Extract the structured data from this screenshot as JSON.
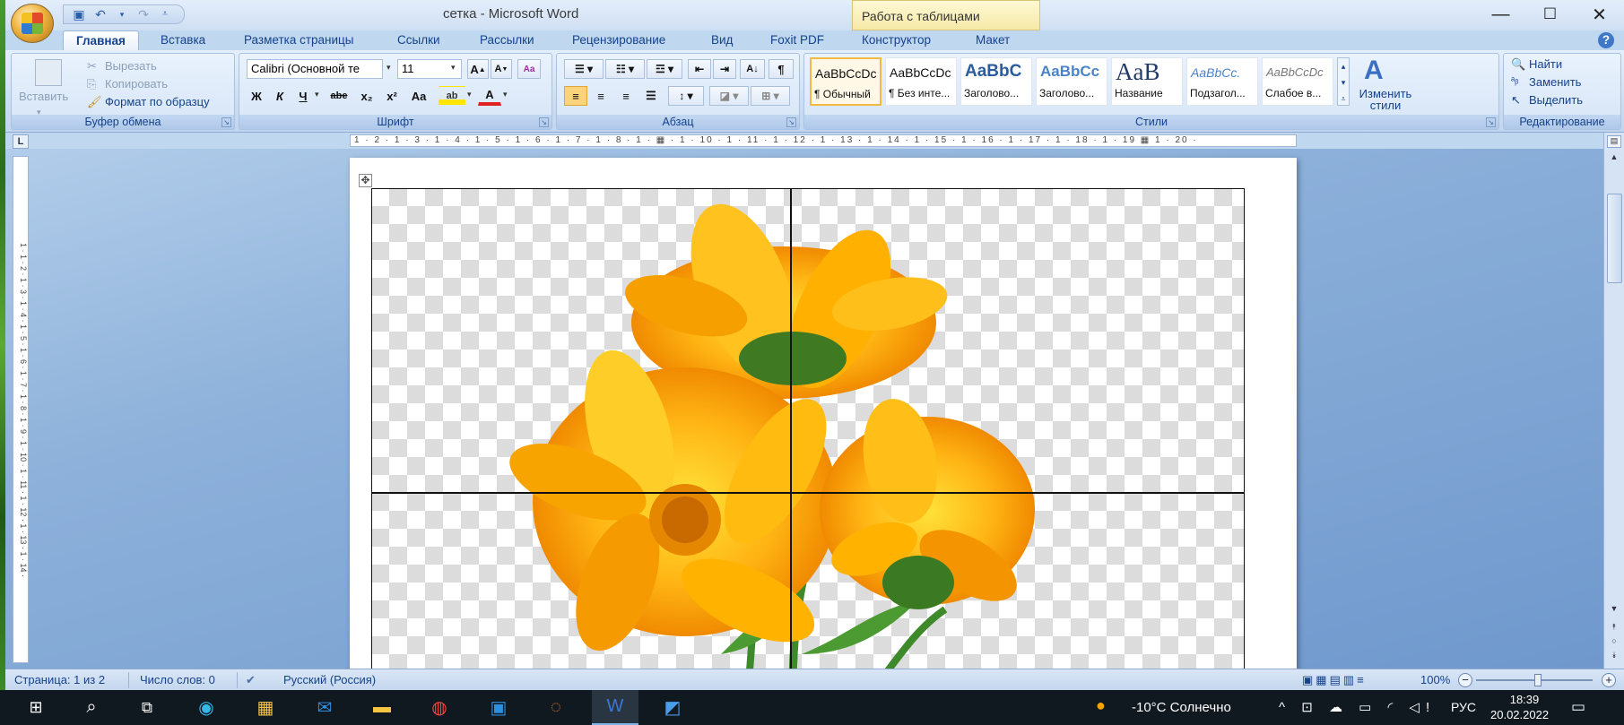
{
  "window": {
    "title": "сетка - Microsoft Word",
    "context_header": "Работа с таблицами",
    "minimize": "—",
    "maximize": "☐",
    "close": "✕"
  },
  "tabs": [
    "Главная",
    "Вставка",
    "Разметка страницы",
    "Ссылки",
    "Рассылки",
    "Рецензирование",
    "Вид",
    "Foxit PDF",
    "Конструктор",
    "Макет"
  ],
  "clipboard": {
    "paste": "Вставить",
    "cut": "Вырезать",
    "copy": "Копировать",
    "format_painter": "Формат по образцу",
    "label": "Буфер обмена"
  },
  "font": {
    "name": "Calibri (Основной те",
    "size": "11",
    "label": "Шрифт",
    "bold": "Ж",
    "italic": "К",
    "underline": "Ч",
    "strike": "abe",
    "sub": "x₂",
    "sup": "x²",
    "case": "Aa"
  },
  "paragraph": {
    "label": "Абзац"
  },
  "styles": {
    "label": "Стили",
    "items": [
      {
        "sample": "AaBbCcDc",
        "name": "¶ Обычный"
      },
      {
        "sample": "AaBbCcDc",
        "name": "¶ Без инте..."
      },
      {
        "sample": "AaBbC",
        "name": "Заголово..."
      },
      {
        "sample": "AaBbCc",
        "name": "Заголово..."
      },
      {
        "sample": "AaB",
        "name": "Название"
      },
      {
        "sample": "AaBbCc.",
        "name": "Подзагол..."
      },
      {
        "sample": "AaBbCcDc",
        "name": "Слабое в..."
      }
    ],
    "change": "Изменить стили"
  },
  "editing": {
    "find": "Найти",
    "replace": "Заменить",
    "select": "Выделить",
    "label": "Редактирование"
  },
  "ruler": {
    "h": "1 · 2 · 1 · 3 · 1 · 4 · 1 · 5 · 1 · 6 · 1 · 7 · 1 · 8 · 1 · ▦ · 1 · 10 · 1 · 11 · 1 · 12 · 1 · 13 · 1 · 14 · 1 · 15 · 1 · 16 · 1 · 17 · 1 · 18 · 1 · 19 ▦ 1 · 20 ·",
    "v": "1 · 1 · 2 · 1 · 3 · 1 · 4 · 1 · 5 · 1 · 6 · 1 · 7 · 1 · 8 · 1 · 9 · 1 · 10 · 1 · 11 · 1 · 12 · 1 · 13 · 1 · 14 ·",
    "corner": "L"
  },
  "status": {
    "page": "Страница: 1 из 2",
    "words": "Число слов: 0",
    "language": "Русский (Россия)",
    "zoom": "100%"
  },
  "taskbar": {
    "weather": "-10°C  Солнечно",
    "lang": "РУС",
    "time": "18:39",
    "date": "20.02.2022"
  }
}
